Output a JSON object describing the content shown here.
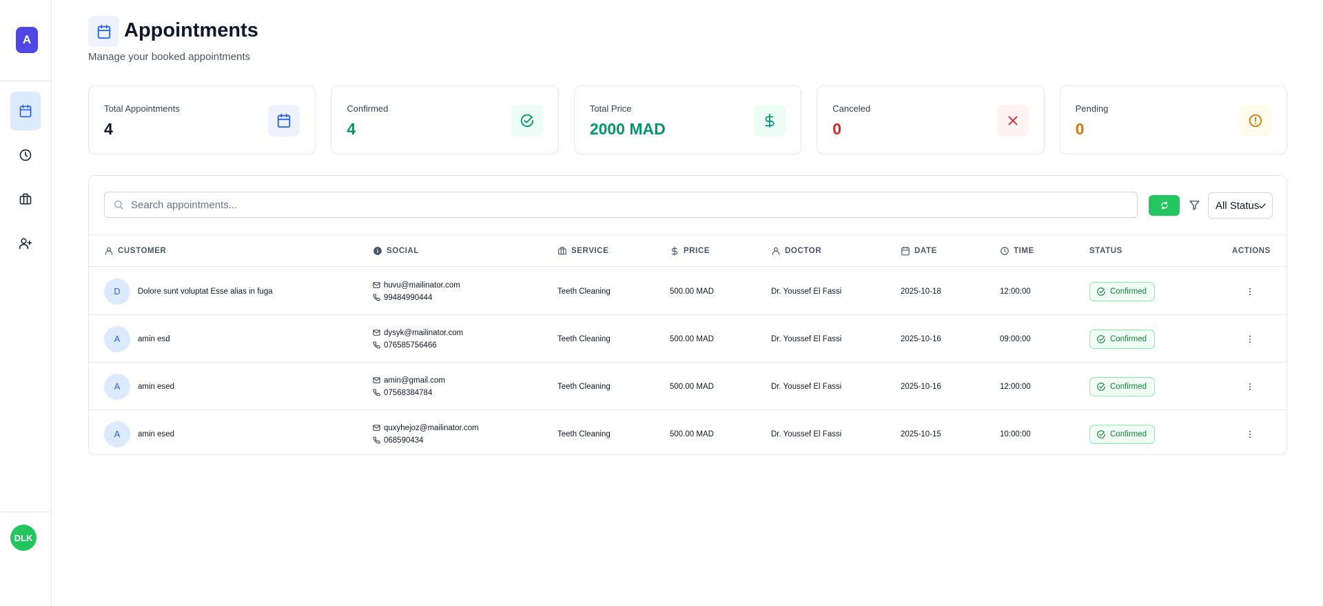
{
  "sidebar": {
    "brand_letter": "A",
    "nav": [
      {
        "name": "calendar-icon",
        "active": true
      },
      {
        "name": "clock-icon",
        "active": false
      },
      {
        "name": "briefcase-icon",
        "active": false
      },
      {
        "name": "user-plus-icon",
        "active": false
      }
    ],
    "user_initials": "DLK"
  },
  "header": {
    "title": "Appointments",
    "subtitle": "Manage your booked appointments"
  },
  "stats": [
    {
      "label": "Total Appointments",
      "value": "4",
      "icon": "calendar-icon",
      "color": "#0f172a",
      "icon_bg": "#eef2ff",
      "icon_color": "#2563eb"
    },
    {
      "label": "Confirmed",
      "value": "4",
      "icon": "check-circle-icon",
      "color": "#059669",
      "icon_bg": "#ecfdf5",
      "icon_color": "#059669"
    },
    {
      "label": "Total Price",
      "value": "2000 MAD",
      "icon": "dollar-icon",
      "color": "#059669",
      "icon_bg": "#ecfdf5",
      "icon_color": "#059669"
    },
    {
      "label": "Canceled",
      "value": "0",
      "icon": "x-icon",
      "color": "#dc2626",
      "icon_bg": "#fef2f2",
      "icon_color": "#dc2626"
    },
    {
      "label": "Pending",
      "value": "0",
      "icon": "alert-circle-icon",
      "color": "#d97706",
      "icon_bg": "#fffbeb",
      "icon_color": "#d97706"
    }
  ],
  "toolbar": {
    "search_placeholder": "Search appointments...",
    "status_filter": "All Status"
  },
  "table": {
    "columns": {
      "customer": "Customer",
      "social": "Social",
      "service": "Service",
      "price": "Price",
      "doctor": "Doctor",
      "date": "Date",
      "time": "Time",
      "status": "Status",
      "actions": "Actions"
    },
    "rows": [
      {
        "initial": "D",
        "customer": "Dolore sunt voluptat Esse alias in fuga",
        "email": "huvu@mailinator.com",
        "phone": "99484990444",
        "service": "Teeth Cleaning",
        "price": "500.00 MAD",
        "doctor": "Dr. Youssef El Fassi",
        "date": "2025-10-18",
        "time": "12:00:00",
        "status": "Confirmed"
      },
      {
        "initial": "A",
        "customer": "amin esd",
        "email": "dysyk@mailinator.com",
        "phone": "076585756466",
        "service": "Teeth Cleaning",
        "price": "500.00 MAD",
        "doctor": "Dr. Youssef El Fassi",
        "date": "2025-10-16",
        "time": "09:00:00",
        "status": "Confirmed"
      },
      {
        "initial": "A",
        "customer": "amin esed",
        "email": "amin@gmail.com",
        "phone": "07568384784",
        "service": "Teeth Cleaning",
        "price": "500.00 MAD",
        "doctor": "Dr. Youssef El Fassi",
        "date": "2025-10-16",
        "time": "12:00:00",
        "status": "Confirmed"
      },
      {
        "initial": "A",
        "customer": "amin esed",
        "email": "quxyhejoz@mailinator.com",
        "phone": "068590434",
        "service": "Teeth Cleaning",
        "price": "500.00 MAD",
        "doctor": "Dr. Youssef El Fassi",
        "date": "2025-10-15",
        "time": "10:00:00",
        "status": "Confirmed"
      }
    ]
  }
}
